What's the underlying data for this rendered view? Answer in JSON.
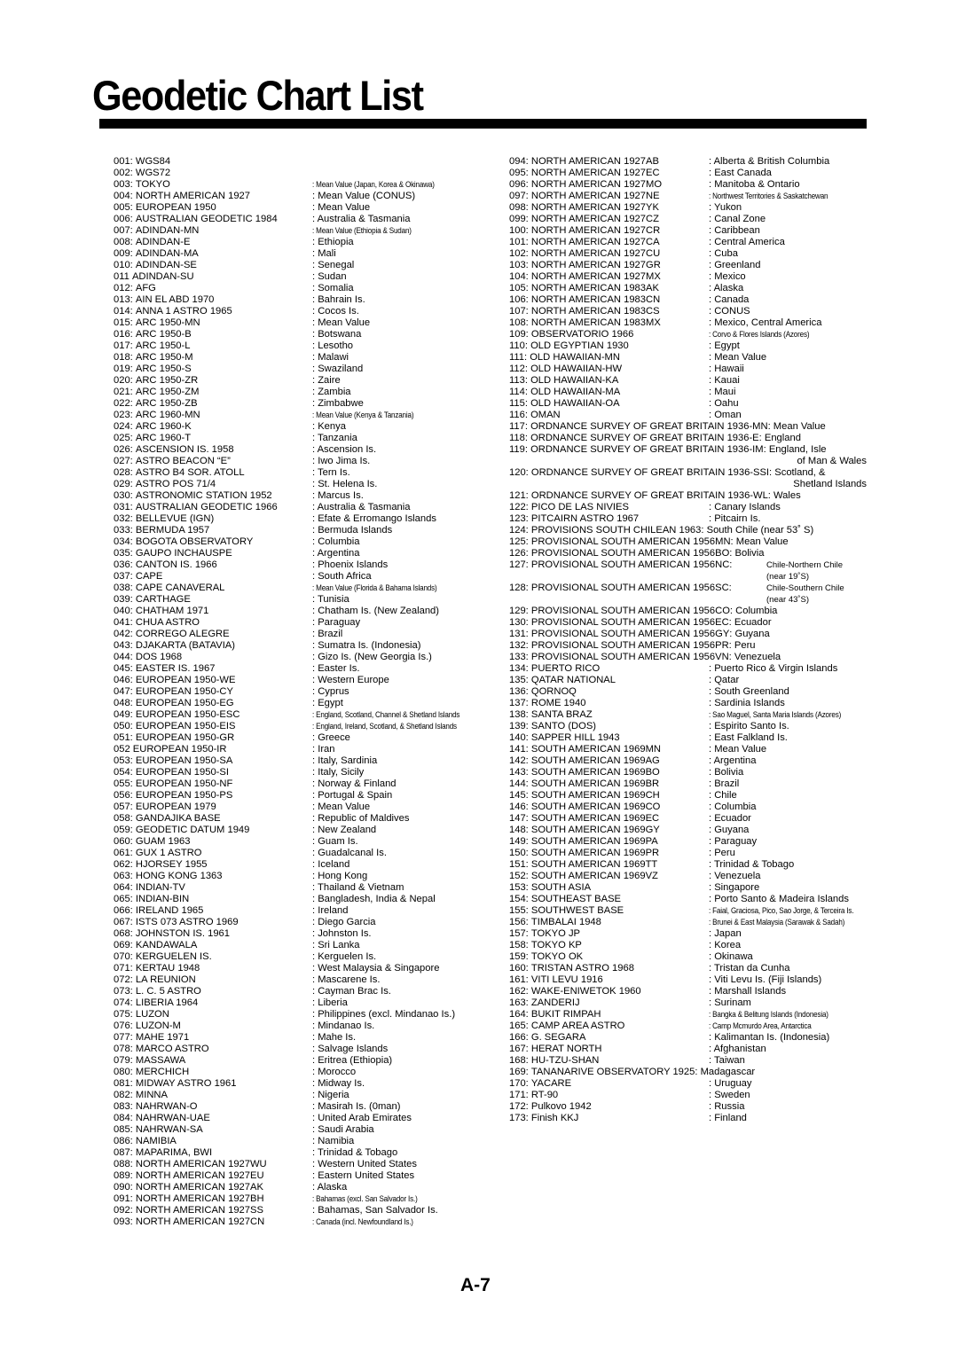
{
  "document": {
    "title": "Geodetic Chart List",
    "page_number": "A-7"
  },
  "left_column": [
    {
      "num": "001:",
      "name": "WGS84",
      "region": ""
    },
    {
      "num": "002:",
      "name": "WGS72",
      "region": ""
    },
    {
      "num": "003:",
      "name": "TOKYO",
      "region": ": Mean Value (Japan, Korea & Okinawa)",
      "small": true
    },
    {
      "num": "004:",
      "name": "NORTH AMERICAN 1927",
      "region": ": Mean Value (CONUS)"
    },
    {
      "num": "005:",
      "name": "EUROPEAN 1950",
      "region": ": Mean Value"
    },
    {
      "num": "006:",
      "name": "AUSTRALIAN GEODETIC 1984",
      "region": ": Australia & Tasmania"
    },
    {
      "num": "007:",
      "name": "ADINDAN-MN",
      "region": ": Mean Value (Ethiopia & Sudan)",
      "small": true
    },
    {
      "num": "008:",
      "name": "ADINDAN-E",
      "region": ": Ethiopia"
    },
    {
      "num": "009:",
      "name": "ADINDAN-MA",
      "region": ": Mali"
    },
    {
      "num": "010:",
      "name": "ADINDAN-SE",
      "region": ": Senegal"
    },
    {
      "num": "011",
      "name": "ADINDAN-SU",
      "region": ": Sudan"
    },
    {
      "num": "012:",
      "name": "AFG",
      "region": ": Somalia"
    },
    {
      "num": "013:",
      "name": "AIN EL ABD 1970",
      "region": ": Bahrain Is."
    },
    {
      "num": "014:",
      "name": "ANNA 1 ASTRO 1965",
      "region": ": Cocos Is."
    },
    {
      "num": "015:",
      "name": "ARC 1950-MN",
      "region": ": Mean Value"
    },
    {
      "num": "016:",
      "name": "ARC 1950-B",
      "region": ": Botswana"
    },
    {
      "num": "017:",
      "name": "ARC 1950-L",
      "region": ": Lesotho"
    },
    {
      "num": "018:",
      "name": "ARC 1950-M",
      "region": ": Malawi"
    },
    {
      "num": "019:",
      "name": "ARC 1950-S",
      "region": ": Swaziland"
    },
    {
      "num": "020:",
      "name": "ARC 1950-ZR",
      "region": ": Zaire"
    },
    {
      "num": "021:",
      "name": "ARC 1950-ZM",
      "region": ": Zambia"
    },
    {
      "num": "022:",
      "name": "ARC 1950-ZB",
      "region": ": Zimbabwe"
    },
    {
      "num": "023:",
      "name": "ARC 1960-MN",
      "region": ": Mean Value (Kenya & Tanzania)",
      "small": true
    },
    {
      "num": "024:",
      "name": "ARC 1960-K",
      "region": ": Kenya"
    },
    {
      "num": "025:",
      "name": "ARC 1960-T",
      "region": ": Tanzania"
    },
    {
      "num": "026:",
      "name": "ASCENSION IS. 1958",
      "region": ": Ascension Is."
    },
    {
      "num": "027:",
      "name": "ASTRO BEACON “E”",
      "region": ": Iwo Jima Is."
    },
    {
      "num": "028:",
      "name": "ASTRO B4 SOR. ATOLL",
      "region": ": Tern Is."
    },
    {
      "num": "029:",
      "name": "ASTRO POS 71/4",
      "region": ": St. Helena Is."
    },
    {
      "num": "030:",
      "name": "ASTRONOMIC STATION 1952",
      "region": ": Marcus Is."
    },
    {
      "num": "031:",
      "name": "AUSTRALIAN GEODETIC 1966",
      "region": ": Australia & Tasmania"
    },
    {
      "num": "032:",
      "name": "BELLEVUE (IGN)",
      "region": ": Efate & Erromango Islands"
    },
    {
      "num": "033:",
      "name": "BERMUDA 1957",
      "region": ": Bermuda Islands"
    },
    {
      "num": "034:",
      "name": "BOGOTA OBSERVATORY",
      "region": ": Columbia"
    },
    {
      "num": "035:",
      "name": "GAUPO INCHAUSPE",
      "region": ": Argentina"
    },
    {
      "num": "036:",
      "name": "CANTON IS. 1966",
      "region": ": Phoenix Islands"
    },
    {
      "num": "037:",
      "name": "CAPE",
      "region": ": South Africa"
    },
    {
      "num": "038:",
      "name": "CAPE CANAVERAL",
      "region": ": Mean Value (Florida & Bahama Islands)",
      "small": true
    },
    {
      "num": "039:",
      "name": "CARTHAGE",
      "region": ": Tunisia"
    },
    {
      "num": "040:",
      "name": "CHATHAM 1971",
      "region": ": Chatham Is. (New Zealand)"
    },
    {
      "num": "041:",
      "name": "CHUA ASTRO",
      "region": ": Paraguay"
    },
    {
      "num": "042:",
      "name": "CORREGO ALEGRE",
      "region": ": Brazil"
    },
    {
      "num": "043:",
      "name": "DJAKARTA (BATAVIA)",
      "region": ": Sumatra Is. (Indonesia)"
    },
    {
      "num": "044:",
      "name": "DOS 1968",
      "region": ": Gizo Is. (New Georgia Is.)"
    },
    {
      "num": "045:",
      "name": "EASTER IS. 1967",
      "region": ": Easter Is."
    },
    {
      "num": "046:",
      "name": "EUROPEAN 1950-WE",
      "region": ": Western Europe"
    },
    {
      "num": "047:",
      "name": "EUROPEAN 1950-CY",
      "region": ": Cyprus"
    },
    {
      "num": "048:",
      "name": "EUROPEAN 1950-EG",
      "region": ": Egypt"
    },
    {
      "num": "049:",
      "name": "EUROPEAN 1950-ESC",
      "region": ": England, Scotland, Channel & Shetland Islands",
      "small": true
    },
    {
      "num": "050:",
      "name": "EUROPEAN 1950-EIS",
      "region": ": England, Ireland, Scotland, &  Shetland Islands",
      "small": true
    },
    {
      "num": "051:",
      "name": "EUROPEAN 1950-GR",
      "region": ": Greece"
    },
    {
      "num": "052",
      "name": "EUROPEAN 1950-IR",
      "region": ": Iran"
    },
    {
      "num": "053:",
      "name": "EUROPEAN 1950-SA",
      "region": ": Italy, Sardinia"
    },
    {
      "num": "054:",
      "name": "EUROPEAN 1950-SI",
      "region": ": Italy, Sicily"
    },
    {
      "num": "055:",
      "name": "EUROPEAN 1950-NF",
      "region": ": Norway & Finland"
    },
    {
      "num": "056:",
      "name": "EUROPEAN 1950-PS",
      "region": ": Portugal & Spain"
    },
    {
      "num": "057:",
      "name": "EUROPEAN 1979",
      "region": ": Mean Value"
    },
    {
      "num": "058:",
      "name": "GANDAJIKA BASE",
      "region": ": Republic of Maldives"
    },
    {
      "num": "059:",
      "name": "GEODETIC DATUM 1949",
      "region": ": New Zealand"
    },
    {
      "num": "060:",
      "name": "GUAM 1963",
      "region": ": Guam Is."
    },
    {
      "num": "061:",
      "name": "GUX 1 ASTRO",
      "region": ": Guadalcanal Is."
    },
    {
      "num": "062:",
      "name": "HJORSEY 1955",
      "region": ": Iceland"
    },
    {
      "num": "063:",
      "name": "HONG KONG 1363",
      "region": ": Hong Kong"
    },
    {
      "num": "064:",
      "name": "INDIAN-TV",
      "region": ": Thailand & Vietnam"
    },
    {
      "num": "065:",
      "name": "INDIAN-BIN",
      "region": ": Bangladesh, India & Nepal"
    },
    {
      "num": "066:",
      "name": "IRELAND 1965",
      "region": ": Ireland"
    },
    {
      "num": "067:",
      "name": "ISTS 073 ASTRO 1969",
      "region": ": Diego Garcia"
    },
    {
      "num": "068:",
      "name": "JOHNSTON IS. 1961",
      "region": ": Johnston Is."
    },
    {
      "num": "069:",
      "name": "KANDAWALA",
      "region": ": Sri Lanka"
    },
    {
      "num": "070:",
      "name": "KERGUELEN IS.",
      "region": ": Kerguelen Is."
    },
    {
      "num": "071:",
      "name": "KERTAU 1948",
      "region": ": West Malaysia & Singapore"
    },
    {
      "num": "072:",
      "name": "LA REUNION",
      "region": ": Mascarene Is."
    },
    {
      "num": "073:",
      "name": "L. C. 5 ASTRO",
      "region": ": Cayman Brac Is."
    },
    {
      "num": "074:",
      "name": "LIBERIA 1964",
      "region": ": Liberia"
    },
    {
      "num": "075:",
      "name": "LUZON",
      "region": ": Philippines (excl. Mindanao Is.)"
    },
    {
      "num": "076:",
      "name": "LUZON-M",
      "region": ": Mindanao Is."
    },
    {
      "num": "077:",
      "name": "MAHE 1971",
      "region": ": Mahe Is."
    },
    {
      "num": "078:",
      "name": "MARCO ASTRO",
      "region": ": Salvage Islands"
    },
    {
      "num": "079:",
      "name": "MASSAWA",
      "region": ": Eritrea (Ethiopia)"
    },
    {
      "num": "080:",
      "name": "MERCHICH",
      "region": ": Morocco"
    },
    {
      "num": "081:",
      "name": "MIDWAY ASTRO 1961",
      "region": ": Midway Is."
    },
    {
      "num": "082:",
      "name": "MINNA",
      "region": ": Nigeria"
    },
    {
      "num": "083:",
      "name": "NAHRWAN-O",
      "region": ": Masirah Is. (0man)"
    },
    {
      "num": "084:",
      "name": "NAHRWAN-UAE",
      "region": ": United Arab Emirates"
    },
    {
      "num": "085:",
      "name": "NAHRWAN-SA",
      "region": ": Saudi Arabia"
    },
    {
      "num": "086:",
      "name": "NAMIBIA",
      "region": ": Namibia"
    },
    {
      "num": "087:",
      "name": "MAPARIMA, BWI",
      "region": ": Trinidad & Tobago"
    },
    {
      "num": "088:",
      "name": "NORTH AMERICAN 1927WU",
      "region": ": Western United States"
    },
    {
      "num": "089:",
      "name": "NORTH AMERICAN 1927EU",
      "region": ": Eastern United States"
    },
    {
      "num": "090:",
      "name": "NORTH AMERICAN 1927AK",
      "region": ": Alaska"
    },
    {
      "num": "091:",
      "name": "NORTH AMERICAN 1927BH",
      "region": ": Bahamas (excl. San Salvador Is.)",
      "small": true
    },
    {
      "num": "092:",
      "name": "NORTH AMERICAN 1927SS",
      "region": ": Bahamas, San Salvador Is."
    },
    {
      "num": "093:",
      "name": "NORTH AMERICAN 1927CN",
      "region": ": Canada (incl. Newfoundland Is.)",
      "small": true
    }
  ],
  "right_column": [
    {
      "num": "094:",
      "name": "NORTH AMERICAN 1927AB",
      "region": ": Alberta & British Columbia"
    },
    {
      "num": "095:",
      "name": "NORTH AMERICAN 1927EC",
      "region": ": East Canada"
    },
    {
      "num": "096:",
      "name": "NORTH AMERICAN 1927MO",
      "region": ": Manitoba & Ontario"
    },
    {
      "num": "097:",
      "name": "NORTH AMERICAN 1927NE",
      "region": ": Northwest Territories & Saskatchewan",
      "small": true
    },
    {
      "num": "098:",
      "name": "NORTH AMERICAN 1927YK",
      "region": ": Yukon"
    },
    {
      "num": "099:",
      "name": "NORTH AMERICAN 1927CZ",
      "region": ": Canal Zone"
    },
    {
      "num": "100:",
      "name": "NORTH AMERICAN 1927CR",
      "region": ": Caribbean"
    },
    {
      "num": "101:",
      "name": "NORTH AMERICAN 1927CA",
      "region": ": Central America"
    },
    {
      "num": "102:",
      "name": "NORTH AMERICAN 1927CU",
      "region": ": Cuba"
    },
    {
      "num": "103:",
      "name": "NORTH AMERICAN 1927GR",
      "region": ": Greenland"
    },
    {
      "num": "104:",
      "name": "NORTH AMERICAN 1927MX",
      "region": ": Mexico"
    },
    {
      "num": "105:",
      "name": "NORTH AMERICAN 1983AK",
      "region": ": Alaska"
    },
    {
      "num": "106:",
      "name": "NORTH AMERICAN 1983CN",
      "region": ": Canada"
    },
    {
      "num": "107:",
      "name": "NORTH AMERICAN 1983CS",
      "region": ": CONUS"
    },
    {
      "num": "108:",
      "name": "NORTH AMERICAN 1983MX",
      "region": ": Mexico, Central America"
    },
    {
      "num": "109:",
      "name": "OBSERVATORIO 1966",
      "region": ": Corvo & Flores Islands (Azores)",
      "small": true
    },
    {
      "num": "110:",
      "name": "OLD EGYPTIAN 1930",
      "region": ": Egypt"
    },
    {
      "num": "111:",
      "name": "OLD HAWAIIAN-MN",
      "region": ": Mean Value"
    },
    {
      "num": "112:",
      "name": "OLD HAWAIIAN-HW",
      "region": ": Hawaii"
    },
    {
      "num": "113:",
      "name": "OLD HAWAIIAN-KA",
      "region": ": Kauai"
    },
    {
      "num": "114:",
      "name": "OLD HAWAIIAN-MA",
      "region": ": Maui"
    },
    {
      "num": "115:",
      "name": "OLD HAWAIIAN-OA",
      "region": ": Oahu"
    },
    {
      "num": "116:",
      "name": "OMAN",
      "region": ": Oman"
    },
    {
      "num": "117:",
      "name": "ORDNANCE SURVEY OF GREAT BRITAIN 1936-MN",
      "region": ": Mean Value",
      "inline": true
    },
    {
      "num": "118:",
      "name": "ORDNANCE SURVEY OF GREAT BRITAIN 1936-E",
      "region": ": England",
      "inline": true
    },
    {
      "num": "119:",
      "name": "ORDNANCE SURVEY OF GREAT BRITAIN 1936-IM",
      "region": ": England, Isle",
      "region2": "of Man & Wales",
      "inline": true
    },
    {
      "num": "120:",
      "name": "ORDNANCE SURVEY OF GREAT BRITAIN 1936-SSI",
      "region": ": Scotland, &",
      "region2": "Shetland Islands",
      "inline": true
    },
    {
      "num": "121:",
      "name": "ORDNANCE SURVEY OF GREAT BRITAIN 1936-WL",
      "region": ": Wales",
      "inline": true
    },
    {
      "num": "122:",
      "name": "PICO DE LAS NIVIES",
      "region": ": Canary Islands"
    },
    {
      "num": "123:",
      "name": "PITCAIRN ASTRO 1967",
      "region": ": Pitcairn Is."
    },
    {
      "num": "124:",
      "name": "PROVISIONS SOUTH CHILEAN 1963",
      "region": ": South Chile (near 53˚ S)",
      "inline": true
    },
    {
      "num": "125:",
      "name": "PROVISIONAL SOUTH AMERICAN 1956MN",
      "region": ": Mean Value",
      "inline": true
    },
    {
      "num": "126:",
      "name": "PROVISIONAL SOUTH AMERICAN 1956BO",
      "region": ":  Bolivia",
      "inline": true
    },
    {
      "num": "127:",
      "name": "PROVISIONAL SOUTH AMERICAN 1956NC",
      "region": ":",
      "ps_region": "Chile-Northern Chile",
      "ps_region2": "(near 19˚S)"
    },
    {
      "num": "128:",
      "name": "PROVISIONAL SOUTH AMERICAN 1956SC",
      "region": ":",
      "ps_region": "Chile-Southern Chile",
      "ps_region2": "(near 43˚S)"
    },
    {
      "num": "129:",
      "name": "PROVISIONAL SOUTH AMERICAN 1956CO",
      "region": ": Columbia",
      "inline": true
    },
    {
      "num": "130:",
      "name": "PROVISIONAL SOUTH AMERICAN 1956EC",
      "region": ":  Ecuador",
      "inline": true
    },
    {
      "num": "131:",
      "name": "PROVISIONAL SOUTH AMERICAN 1956GY",
      "region": ":  Guyana",
      "inline": true
    },
    {
      "num": "132:",
      "name": "PROVISIONAL SOUTH AMERICAN 1956PR",
      "region": ":  Peru",
      "inline": true
    },
    {
      "num": "133:",
      "name": "PROVISIONAL SOUTH AMERICAN 1956VN",
      "region": ":  Venezuela",
      "inline": true
    },
    {
      "num": "134:",
      "name": "PUERTO RICO",
      "region": ": Puerto Rico & Virgin Islands"
    },
    {
      "num": "135:",
      "name": "QATAR NATIONAL",
      "region": ": Qatar"
    },
    {
      "num": "136:",
      "name": "QORNOQ",
      "region": ": South Greenland"
    },
    {
      "num": "137:",
      "name": "ROME 1940",
      "region": ": Sardinia Islands"
    },
    {
      "num": "138:",
      "name": "SANTA BRAZ",
      "region": ": Sao Maguel, Santa Maria Islands (Azores)",
      "small": true
    },
    {
      "num": "139:",
      "name": "SANTO (DOS)",
      "region": ": Espirito Santo Is."
    },
    {
      "num": "140:",
      "name": "SAPPER HILL 1943",
      "region": ": East Falkland Is."
    },
    {
      "num": "141:",
      "name": "SOUTH AMERICAN 1969MN",
      "region": ": Mean Value"
    },
    {
      "num": "142:",
      "name": "SOUTH AMERICAN 1969AG",
      "region": ": Argentina"
    },
    {
      "num": "143:",
      "name": "SOUTH AMERICAN 1969BO",
      "region": ": Bolivia"
    },
    {
      "num": "144:",
      "name": "SOUTH AMERICAN 1969BR",
      "region": ": Brazil"
    },
    {
      "num": "145:",
      "name": "SOUTH AMERICAN 1969CH",
      "region": ": Chile"
    },
    {
      "num": "146:",
      "name": "SOUTH AMERICAN 1969CO",
      "region": ": Columbia"
    },
    {
      "num": "147:",
      "name": "SOUTH AMERICAN 1969EC",
      "region": ": Ecuador"
    },
    {
      "num": "148:",
      "name": "SOUTH AMERICAN 1969GY",
      "region": ": Guyana"
    },
    {
      "num": "149:",
      "name": "SOUTH AMERICAN 1969PA",
      "region": ": Paraguay"
    },
    {
      "num": "150:",
      "name": "SOUTH AMERICAN 1969PR",
      "region": ": Peru"
    },
    {
      "num": "151:",
      "name": "SOUTH AMERICAN 1969TT",
      "region": ": Trinidad & Tobago"
    },
    {
      "num": "152:",
      "name": "SOUTH AMERICAN 1969VZ",
      "region": ": Venezuela"
    },
    {
      "num": "153:",
      "name": "SOUTH ASIA",
      "region": ": Singapore"
    },
    {
      "num": "154:",
      "name": "SOUTHEAST BASE",
      "region": ": Porto Santo & Madeira Islands"
    },
    {
      "num": "155:",
      "name": "SOUTHWEST BASE",
      "region": ": Faial, Graciosa, Pico, Sao Jorge, & Terceira Is.",
      "small": true
    },
    {
      "num": "156:",
      "name": "TIMBALAI 1948",
      "region": ": Brunei & East Malaysia (Sarawak & Sadah)",
      "small": true
    },
    {
      "num": "157:",
      "name": "TOKYO JP",
      "region": ": Japan"
    },
    {
      "num": "158:",
      "name": "TOKYO KP",
      "region": ": Korea"
    },
    {
      "num": "159:",
      "name": "TOKYO OK",
      "region": ": Okinawa"
    },
    {
      "num": "160:",
      "name": "TRISTAN ASTRO 1968",
      "region": ": Tristan da Cunha"
    },
    {
      "num": "161:",
      "name": "VITI LEVU 1916",
      "region": ": Viti Levu Is. (Fiji Islands)"
    },
    {
      "num": "162:",
      "name": "WAKE-ENIWETOK 1960",
      "region": ": Marshall Islands"
    },
    {
      "num": "163:",
      "name": "ZANDERIJ",
      "region": ": Surinam"
    },
    {
      "num": "164:",
      "name": "BUKIT RIMPAH",
      "region": ": Bangka & Belitung Islands (Indonesia)",
      "small": true
    },
    {
      "num": "165:",
      "name": "CAMP AREA ASTRO",
      "region": ": Camp Mcmurdo Area, Antarctica",
      "small": true
    },
    {
      "num": "166:",
      "name": "G. SEGARA",
      "region": ": Kalimantan Is. (Indonesia)"
    },
    {
      "num": "167:",
      "name": "HERAT NORTH",
      "region": ": Afghanistan"
    },
    {
      "num": "168:",
      "name": "HU-TZU-SHAN",
      "region": ": Taiwan"
    },
    {
      "num": "169:",
      "name": "TANANARIVE OBSERVATORY 1925",
      "region": ": Madagascar",
      "inline": true
    },
    {
      "num": "170:",
      "name": "YACARE",
      "region": ": Uruguay"
    },
    {
      "num": "171:",
      "name": "RT-90",
      "region": ": Sweden"
    },
    {
      "num": "172:",
      "name": "Pulkovo 1942",
      "region": ": Russia"
    },
    {
      "num": "173:",
      "name": "Finish KKJ",
      "region": ": Finland"
    }
  ]
}
